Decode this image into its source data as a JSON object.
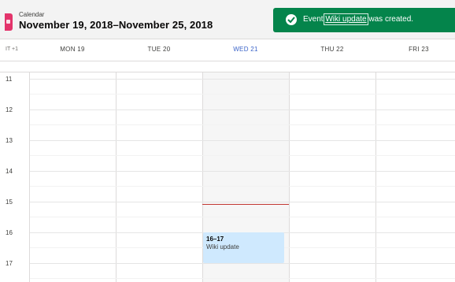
{
  "header": {
    "label": "Calendar",
    "title": "November 19, 2018–November 25, 2018"
  },
  "toast": {
    "prefix": "Event",
    "link_text": "Wiki update",
    "suffix": "was created.",
    "color": "#04844b",
    "icon": "check-icon"
  },
  "timezone_label": "IT +1",
  "days": [
    {
      "label": "MON 19",
      "today": false
    },
    {
      "label": "TUE 20",
      "today": false
    },
    {
      "label": "WED 21",
      "today": true
    },
    {
      "label": "THU 22",
      "today": false
    },
    {
      "label": "FRI 23",
      "today": false
    }
  ],
  "hours": [
    "11",
    "12",
    "13",
    "14",
    "15",
    "16",
    "17"
  ],
  "event": {
    "time": "16–17",
    "title": "Wiki update",
    "color": "#cfe9fe"
  },
  "colors": {
    "today_header": "#3a63c8",
    "now_indicator": "#c23934"
  }
}
